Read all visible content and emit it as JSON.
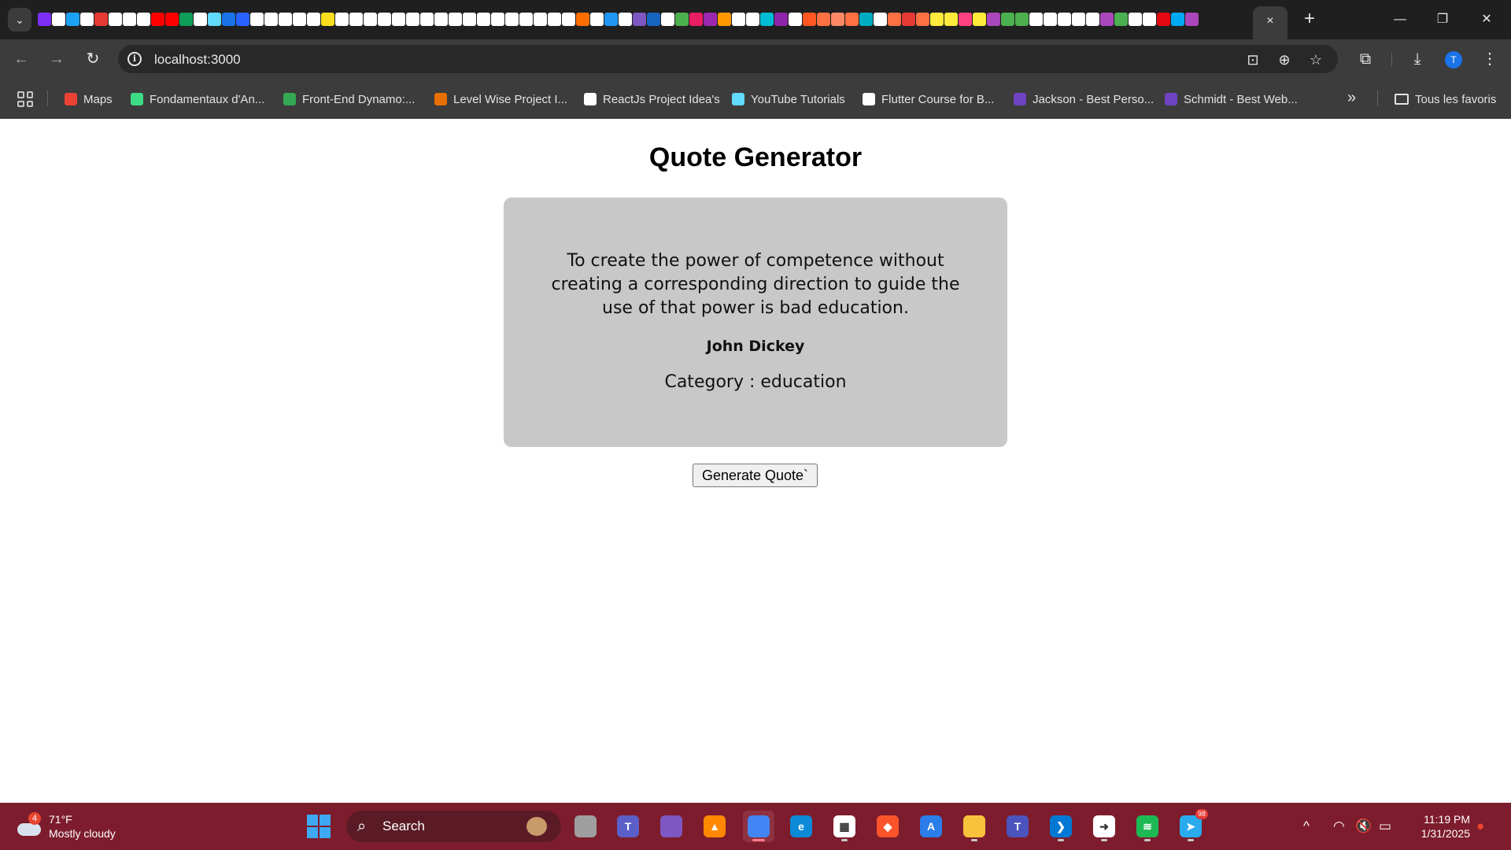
{
  "browser": {
    "tab_search_icon": "chevron-down-icon",
    "pinned_tab_colors": [
      "#7b2ff7",
      "#ffffff",
      "#1da1f2",
      "#ffffff",
      "#e53935",
      "#ffffff",
      "#ffffff",
      "#ffffff",
      "#ff0000",
      "#ff0000",
      "#0f9d58",
      "#ffffff",
      "#61dafb",
      "#1a73e8",
      "#2962ff",
      "#ffffff",
      "#ffffff",
      "#ffffff",
      "#ffffff",
      "#ffffff",
      "#f7df1e",
      "#ffffff",
      "#ffffff",
      "#ffffff",
      "#ffffff",
      "#ffffff",
      "#ffffff",
      "#ffffff",
      "#ffffff",
      "#ffffff",
      "#ffffff",
      "#ffffff",
      "#ffffff",
      "#ffffff",
      "#ffffff",
      "#ffffff",
      "#ffffff",
      "#ffffff",
      "#ff6d00",
      "#ffffff",
      "#2196f3",
      "#ffffff",
      "#7e57c2",
      "#1565c0",
      "#ffffff",
      "#4caf50",
      "#e91e63",
      "#9c27b0",
      "#ff9800",
      "#ffffff",
      "#ffffff",
      "#00bcd4",
      "#8e24aa",
      "#ffffff",
      "#ff5722",
      "#ff7043",
      "#ff8a65",
      "#ff7043",
      "#00acc1",
      "#ffffff",
      "#ff7043",
      "#e53935",
      "#ff7043",
      "#ffeb3b",
      "#ffeb3b",
      "#ff4081",
      "#ffeb3b",
      "#ab47bc",
      "#4caf50",
      "#4caf50",
      "#ffffff",
      "#ffffff",
      "#ffffff",
      "#ffffff",
      "#ffffff",
      "#ab47bc",
      "#4caf50",
      "#ffffff",
      "#ffffff",
      "#e50914",
      "#03a9f4",
      "#ab47bc"
    ],
    "active_tab_close": "×",
    "new_tab": "+",
    "window_controls": {
      "minimize": "—",
      "restore": "❐",
      "close": "✕"
    },
    "toolbar": {
      "back": "←",
      "forward": "→",
      "reload": "↻",
      "site_info": "i",
      "url": "localhost:3000",
      "install_icon": "install-app-icon",
      "zoom_icon": "zoom-icon",
      "bookmark_star": "☆",
      "extensions_icon": "puzzle-icon",
      "download_icon": "⤓",
      "profile_initial": "T",
      "menu": "⋮"
    },
    "bookmarks": [
      {
        "label": "Maps",
        "icon": "maps-icon",
        "color": "#ea4335"
      },
      {
        "label": "Fondamentaux d'An...",
        "icon": "android-icon",
        "color": "#3ddc84"
      },
      {
        "label": "Front-End Dynamo:...",
        "icon": "doc-icon",
        "color": "#34a853"
      },
      {
        "label": "Level Wise Project I...",
        "icon": "java-icon",
        "color": "#e76f00"
      },
      {
        "label": "ReactJs Project Idea's",
        "icon": "notion-icon",
        "color": "#ffffff"
      },
      {
        "label": "YouTube Tutorials",
        "icon": "react-icon",
        "color": "#61dafb"
      },
      {
        "label": "Flutter Course for B...",
        "icon": "cs-icon",
        "color": "#ffffff"
      },
      {
        "label": "Jackson - Best Perso...",
        "icon": "colorlib-icon",
        "color": "#6f42c1"
      },
      {
        "label": "Schmidt - Best Web...",
        "icon": "colorlib-icon",
        "color": "#6f42c1"
      }
    ],
    "bookmarks_overflow": "»",
    "all_bookmarks": "Tous les favoris"
  },
  "page": {
    "title": "Quote Generator",
    "quote": {
      "text": "To create the power of competence without creating a corresponding direction to guide the use of that power is bad education.",
      "author": "John Dickey",
      "category": "Category : education"
    },
    "generate_button": "Generate Quote`"
  },
  "taskbar": {
    "weather": {
      "badge": "4",
      "temperature": "71°F",
      "condition": "Mostly cloudy"
    },
    "search_label": "Search",
    "apps": [
      {
        "name": "task-view",
        "color": "#9e9e9e",
        "glyph": ""
      },
      {
        "name": "teams",
        "color": "#5b5fc7",
        "glyph": "T"
      },
      {
        "name": "copilot",
        "color": "#7e57c2",
        "glyph": ""
      },
      {
        "name": "vlc",
        "color": "#ff8800",
        "glyph": "▲"
      },
      {
        "name": "chrome",
        "color": "#4285f4",
        "glyph": ""
      },
      {
        "name": "edge",
        "color": "#0c8ad8",
        "glyph": "e"
      },
      {
        "name": "store",
        "color": "#ffffff",
        "glyph": "▦"
      },
      {
        "name": "brave",
        "color": "#fb542b",
        "glyph": "◆"
      },
      {
        "name": "appstore",
        "color": "#2b7de9",
        "glyph": "A"
      },
      {
        "name": "file-explorer",
        "color": "#f9c23c",
        "glyph": ""
      },
      {
        "name": "teams-work",
        "color": "#4b53bc",
        "glyph": "T"
      },
      {
        "name": "vscode",
        "color": "#0078d4",
        "glyph": "❯"
      },
      {
        "name": "file-move",
        "color": "#ffffff",
        "glyph": "➜"
      },
      {
        "name": "spotify",
        "color": "#1db954",
        "glyph": "≋"
      },
      {
        "name": "telegram",
        "color": "#2aabee",
        "glyph": "➤"
      }
    ],
    "telegram_badge": "98",
    "tray": {
      "chevron": "^",
      "wifi": "wifi-icon",
      "volume": "muted-speaker-icon",
      "battery": "battery-icon"
    },
    "time": "11:19 PM",
    "date": "1/31/2025",
    "notification_icon": "bell-icon"
  }
}
